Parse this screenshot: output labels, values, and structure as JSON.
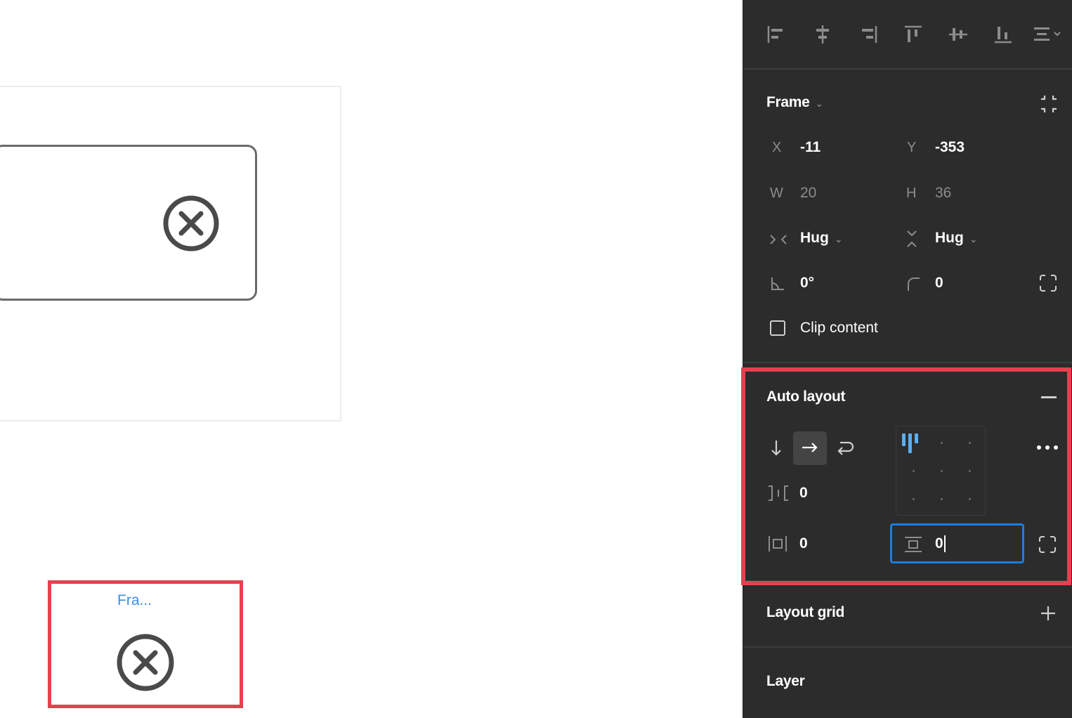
{
  "canvas": {
    "frame_label": "Fra..."
  },
  "panel": {
    "frame_section": {
      "title": "Frame",
      "x_label": "X",
      "x_value": "-11",
      "y_label": "Y",
      "y_value": "-353",
      "w_label": "W",
      "w_value": "20",
      "h_label": "H",
      "h_value": "36",
      "h_resize": "Hug",
      "v_resize": "Hug",
      "rotation": "0°",
      "corner_radius": "0",
      "clip_content": "Clip content"
    },
    "auto_layout": {
      "title": "Auto layout",
      "gap_value": "0",
      "h_padding_value": "0",
      "v_padding_value": "0"
    },
    "layout_grid": {
      "title": "Layout grid"
    },
    "layer": {
      "title": "Layer"
    }
  },
  "colors": {
    "panel_bg": "#2c2c2c",
    "highlight": "#e5404f",
    "focus_blue": "#1b7ddf",
    "alignment_blue": "#5aaef0"
  }
}
